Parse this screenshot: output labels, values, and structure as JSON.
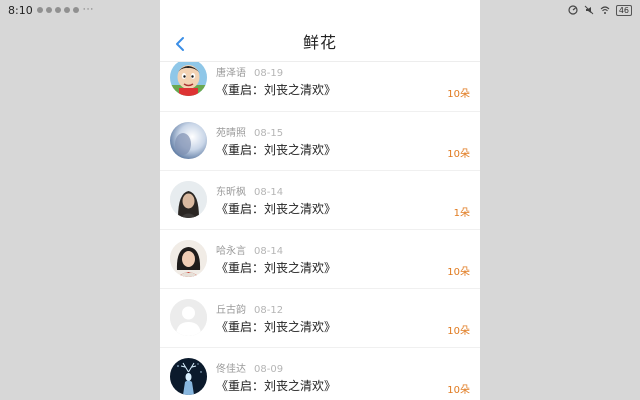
{
  "status": {
    "time": "8:10",
    "more": "···",
    "battery": "46"
  },
  "header": {
    "title": "鲜花"
  },
  "items": [
    {
      "user": "唐泽语",
      "date": "08-19",
      "book": "《重启：刘丧之清欢》",
      "count": "10朵",
      "avatar": "cartoon-avatar"
    },
    {
      "user": "苑晴照",
      "date": "08-15",
      "book": "《重启：刘丧之清欢》",
      "count": "10朵",
      "avatar": "blurred-photo-avatar"
    },
    {
      "user": "东昕枫",
      "date": "08-14",
      "book": "《重启：刘丧之清欢》",
      "count": "1朵",
      "avatar": "portrait-avatar"
    },
    {
      "user": "哈永言",
      "date": "08-14",
      "book": "《重启：刘丧之清欢》",
      "count": "10朵",
      "avatar": "photo-avatar"
    },
    {
      "user": "丘古韵",
      "date": "08-12",
      "book": "《重启：刘丧之清欢》",
      "count": "10朵",
      "avatar": "default-avatar"
    },
    {
      "user": "佟佳达",
      "date": "08-09",
      "book": "《重启：刘丧之清欢》",
      "count": "10朵",
      "avatar": "deer-avatar"
    }
  ],
  "colors": {
    "accent": "#e07a1f",
    "back": "#3a8ee6"
  }
}
